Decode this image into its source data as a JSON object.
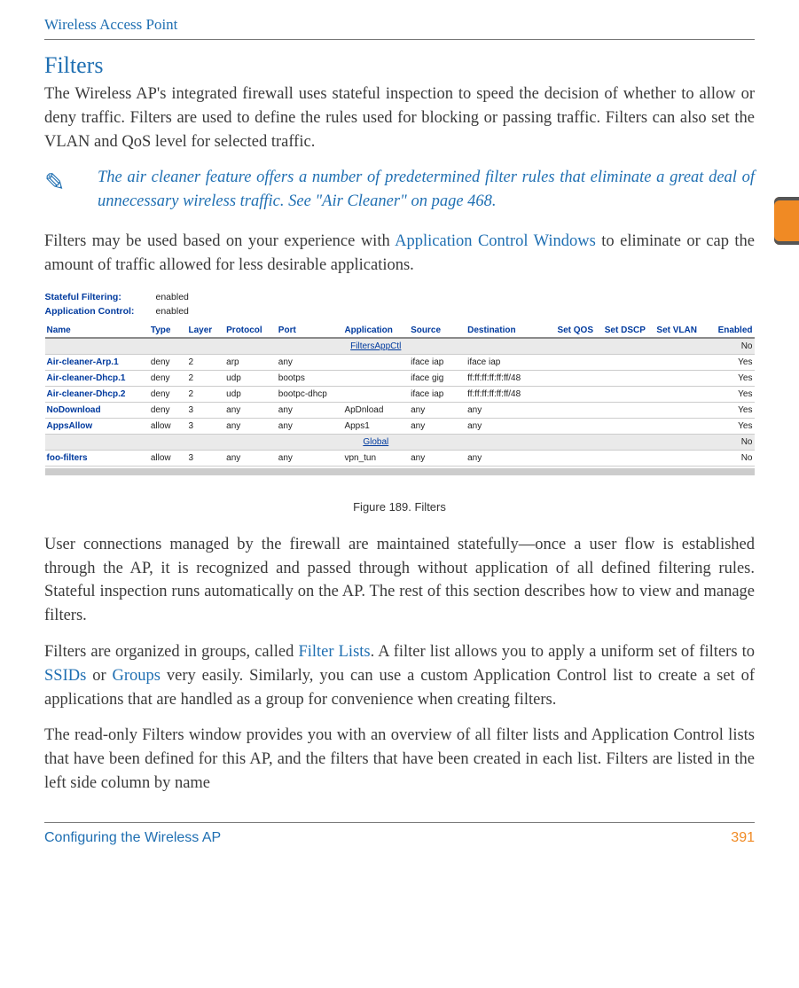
{
  "header": {
    "running_title": "Wireless Access Point"
  },
  "section": {
    "title": "Filters",
    "para1_a": "The Wireless AP's integrated firewall uses stateful inspection to speed the decision of whether to allow or deny traffic. Filters are used to define the rules used for blocking or passing traffic. Filters can also set the VLAN and QoS level for selected traffic."
  },
  "note": {
    "icon_glyph": "✎",
    "text": "The air cleaner feature offers a number of predetermined filter rules that eliminate a great deal of unnecessary wireless traffic. See \"Air Cleaner\" on page 468."
  },
  "para2": {
    "pre": "Filters may be used based on your experience with ",
    "link": "Application Control Windows",
    "post": " to eliminate or cap the amount of traffic allowed for less desirable applications."
  },
  "screenshot": {
    "kv": [
      {
        "label": "Stateful Filtering:",
        "value": "enabled"
      },
      {
        "label": "Application Control:",
        "value": "enabled"
      }
    ],
    "columns": [
      "Name",
      "Type",
      "Layer",
      "Protocol",
      "Port",
      "Application",
      "Source",
      "Destination",
      "Set QOS",
      "Set DSCP",
      "Set VLAN",
      "Enabled"
    ],
    "rows": [
      {
        "group": true,
        "name": "FiltersAppCtl",
        "enabled": "No"
      },
      {
        "name": "Air-cleaner-Arp.1",
        "type": "deny",
        "layer": "2",
        "protocol": "arp",
        "port": "any",
        "application": "",
        "source": "iface iap",
        "destination": "iface iap",
        "setqos": "",
        "setdscp": "",
        "setvlan": "",
        "enabled": "Yes"
      },
      {
        "name": "Air-cleaner-Dhcp.1",
        "type": "deny",
        "layer": "2",
        "protocol": "udp",
        "port": "bootps",
        "application": "",
        "source": "iface gig",
        "destination": "ff:ff:ff:ff:ff:ff/48",
        "setqos": "",
        "setdscp": "",
        "setvlan": "",
        "enabled": "Yes"
      },
      {
        "name": "Air-cleaner-Dhcp.2",
        "type": "deny",
        "layer": "2",
        "protocol": "udp",
        "port": "bootpc-dhcp",
        "application": "",
        "source": "iface iap",
        "destination": "ff:ff:ff:ff:ff:ff/48",
        "setqos": "",
        "setdscp": "",
        "setvlan": "",
        "enabled": "Yes"
      },
      {
        "name": "NoDownload",
        "type": "deny",
        "layer": "3",
        "protocol": "any",
        "port": "any",
        "application": "ApDnload",
        "source": "any",
        "destination": "any",
        "setqos": "",
        "setdscp": "",
        "setvlan": "",
        "enabled": "Yes"
      },
      {
        "name": "AppsAllow",
        "type": "allow",
        "layer": "3",
        "protocol": "any",
        "port": "any",
        "application": "Apps1",
        "source": "any",
        "destination": "any",
        "setqos": "",
        "setdscp": "",
        "setvlan": "",
        "enabled": "Yes"
      },
      {
        "group": true,
        "name": "Global",
        "enabled": "No"
      },
      {
        "name": "foo-filters",
        "type": "allow",
        "layer": "3",
        "protocol": "any",
        "port": "any",
        "application": "vpn_tun",
        "source": "any",
        "destination": "any",
        "setqos": "",
        "setdscp": "",
        "setvlan": "",
        "enabled": "No"
      }
    ]
  },
  "figure_caption": "Figure 189. Filters",
  "para3": "User connections managed by the firewall are maintained statefully—once a user flow is established through the AP, it is recognized and passed through without application of all defined filtering rules. Stateful inspection runs automatically on the AP. The rest of this section describes how to view and manage filters.",
  "para4": {
    "a": "Filters are organized in groups, called ",
    "link1": "Filter Lists",
    "b": ". A filter list allows you to apply a uniform set of filters to ",
    "link2": "SSIDs",
    "c": " or ",
    "link3": "Groups",
    "d": " very easily. Similarly, you can use a custom Application Control list to create a set of applications that are handled as a group for convenience when creating filters."
  },
  "para5": "The read-only Filters window provides you with an overview of all filter lists and Application Control lists that have been defined for this AP, and the filters that have been created in each list. Filters are listed in the left side column by name",
  "footer": {
    "section": "Configuring the Wireless AP",
    "page": "391"
  }
}
